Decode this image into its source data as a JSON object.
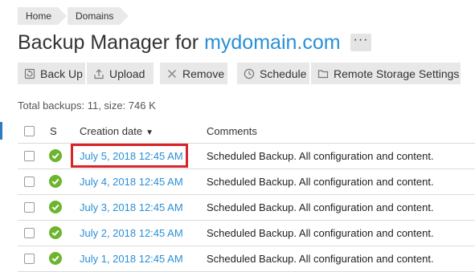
{
  "breadcrumb": {
    "items": [
      "Home",
      "Domains"
    ]
  },
  "page": {
    "title_prefix": "Backup Manager for ",
    "domain": "mydomain.com",
    "more_label": "···"
  },
  "toolbar": {
    "back_up": "Back Up",
    "upload": "Upload",
    "remove": "Remove",
    "schedule": "Schedule",
    "remote_storage": "Remote Storage Settings"
  },
  "summary": "Total backups: 11, size: 746 K",
  "table": {
    "headers": {
      "status": "S",
      "creation_date": "Creation date",
      "comments": "Comments"
    },
    "rows": [
      {
        "date": "July 5, 2018 12:45 AM",
        "comment": "Scheduled Backup. All configuration and content."
      },
      {
        "date": "July 4, 2018 12:45 AM",
        "comment": "Scheduled Backup. All configuration and content."
      },
      {
        "date": "July 3, 2018 12:45 AM",
        "comment": "Scheduled Backup. All configuration and content."
      },
      {
        "date": "July 2, 2018 12:45 AM",
        "comment": "Scheduled Backup. All configuration and content."
      },
      {
        "date": "July 1, 2018 12:45 AM",
        "comment": "Scheduled Backup. All configuration and content."
      }
    ]
  },
  "colors": {
    "link": "#2b8fd6",
    "status_ok": "#6cb52d",
    "highlight": "#d8232a",
    "button_bg": "#e8e8e8"
  },
  "icons": [
    "back-up-icon",
    "upload-icon",
    "remove-icon",
    "schedule-icon",
    "folder-icon",
    "status-ok-icon",
    "sort-desc-icon"
  ]
}
